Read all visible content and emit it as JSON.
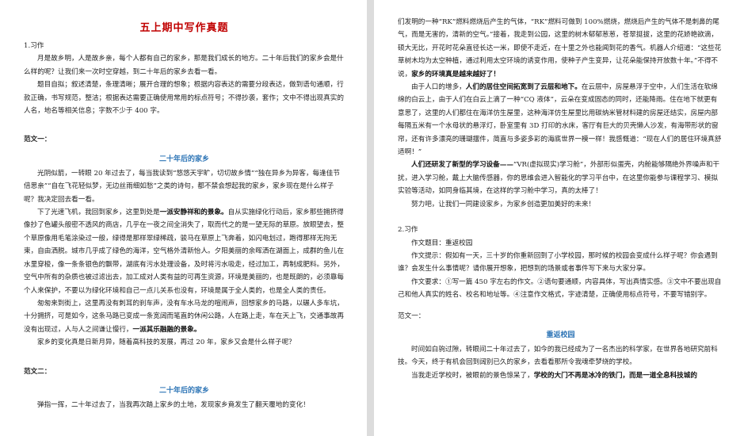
{
  "left": {
    "title": "五上期中写作真题",
    "section1": "1.习作",
    "l_p1": "月是故乡明，人是故乡亲，每个人都有自己的家乡，那是我们成长的地方。二十年后我们的家乡会是什么样的呢？让我们来一次时空穿越，到二十年后的家乡去看一看。",
    "l_p2": "题目自拟；叙述清楚，条理清晰；展开合理的想象；根据内容表达的需要分段表达，做到语句通顺，行款正确，书写规范，整洁；根据表达需要正确使用常用的标点符号；不得抄袭，套作；文中不得出现真实的人名，地名等相关信息；字数不少于 400 字。",
    "fan1_label": "范文一：",
    "essay1_title": "二十年后的家乡",
    "e1_p1": "光阴似箭，一转眼 20 年过去了，每当我读到“悠悠天宇旷，切切故乡情”“独在异乡为异客，每逢佳节倍思亲”“自在飞花轻似梦，无边丝雨细如愁”之类的诗句，都不禁会想起我的家乡，家乡现在是什么样子呢？我决定回去看一看。",
    "e1_p2_a": "下了光速飞机，我回到家乡，这里到处是",
    "e1_p2_b": "一派安静祥和的景象。",
    "e1_p2_c": "自从实施绿化行动后，家乡那些拥挤得像抄了色罐头般密不透风的商店，几乎在一夜之间全消失了，取而代之的是一望无际的草原。放眼望去，整个草原像用毛笔涂染过一般，绿得是那样翠绿稀疏，骏马在草原上飞奔着，如闪电划过，跑得那样无拘无束，自由洒脱。城市几乎成了绿色的海洋，空气格外清新怡人。夕阳美丽的余晖洒在湖面上，成群的鱼儿在水里穿梭，像一条条银色的飘带，湖底有污水处理设备，及时将污水吸走，经过加工，再制成肥料。另外，空气中所有的杂质也被过滤出去，加工成对人类有益的可再生资源，环境是美丽的，也是既朗的，必须靠每个人来保护，不要以为绿化环境和自己一点儿关系也没有，环境是属于全人类的，也是全人类的责任。",
    "e1_p3_a": "匆匆来到街上，这里再没有刺耳的刹车声，没有车水马龙的喧闹声，回想家乡的马路，以碾人多车坑，十分拥挤，可是如今，这条马路已变成一条宽阔而笔直的休闲公路，人在路上走，车在天上飞，交通事故再没有出现过，人与人之间谦让慢行，",
    "e1_p3_b": "一派其乐融融的景象。",
    "e1_p4": "家乡的变化真是日新月异，随着高科技的发展，再过 20 年，家乡又会是什么样子呢？",
    "fan2_label": "范文二：",
    "essay2_title": "二十年后的家乡",
    "e2_p1": "弹指一挥，二十年过去了，当我再次踏上家乡的土地，发现家乡竟发生了翻天覆地的变化！"
  },
  "right": {
    "r_p1_a": "们发明的一种“RK”燃料燃烧后产生的气体，“RK”燃料可做到 100%燃烧，燃烧后产生的气体不是刺鼻的尾气，而是无害的，清新的空气。”接着，我走到公园，这里的树木郁郁葱葱，苍翠挺拔，这里的花娇艳欲滴，硕大无比，开花时花朵直径长达一米，即使不走近，在十里之外也能闻到花的香气。机器人介绍道：“这些花草树木均为太空种植，通过利用太空环境的诱变作用，使种子产生变异，让花朵能保持开放数十年。”不得不说，",
    "r_p1_b": "家乡的环境真是越来越好了！",
    "r_p2_a": "由于人口的增多，",
    "r_p2_b": "人们的居住空间拓宽到了云层和地下。",
    "r_p2_c": "在云层中，房屋悬浮于空中，人们生活在软绵绵的白云上，由于人们在白云上滴了一种“CQ 液体”，云朵在变成固态的同时，还能降雨。住在地下就更有意思了，这里的人们都住在海洋仿生屋里，这种海洋仿生屋里比用碳纳米管材料建的房屋还结实，房屋内部每隔五米有一个水母状的悬浮灯，卧室里有 3D 打印的水床，客厅有巨大的贝壳懒人沙发，有海带形状的窗帘，还有许多漂亮的珊瑚摆件，简直与多姿多彩的海底世界一模一样！我感慨道：“现在人们的居住环境真舒适啊！”",
    "r_p3_a": "人们还研发了新型的学习设备——",
    "r_p3_b": "“VR(虚拟现实)学习舱”，外部形似蛋壳，内舱能够隔绝外界噪声和干扰，进入学习舱，戴上大脑传感器，你的思维会进入智能化的学习平台中，在这里你能参与课程学习、模拟实验等活动，如同身临其境，在这样的学习舱中学习，真的太棒了！",
    "r_p4": "努力吧，让我们一同建设家乡，为家乡创造更加美好的未来！",
    "section2": "2.习作",
    "task_title": "作文题目：重返校园",
    "task_hint": "作文提示：假如有一天，三十岁的你重新回到了小学校园，那时候的校园会变成什么样子呢？你会遇到谁？会发生什么事情呢？请你展开想象，把想到的场景或者事件写下来与大家分享。",
    "task_req": "作文要求：①写一篇 450 字左右的作文。②语句要通顺，内容具体，写出真情实感。③文中不要出现自己和他人真实的姓名、校名和地址等。④注意作文格式，字迹清楚，正确使用标点符号，不要写错别字。",
    "fan1_label": "范文一：",
    "essay_title": "重返校园",
    "r_e_p1": "时间如白驹过隙，转眼间二十年过去了，如今的我已经成为了一名杰出的科学家，在世界各地研究前科技。今天，终于有机会回到阔别已久的家乡，去看看那所令我魂牵梦绕的学校。",
    "r_e_p2_a": "当我走近学校时，被眼前的景色惊呆了，",
    "r_e_p2_b": "学校的大门不再是冰冷的铁门，而是一道全息科技城的"
  }
}
